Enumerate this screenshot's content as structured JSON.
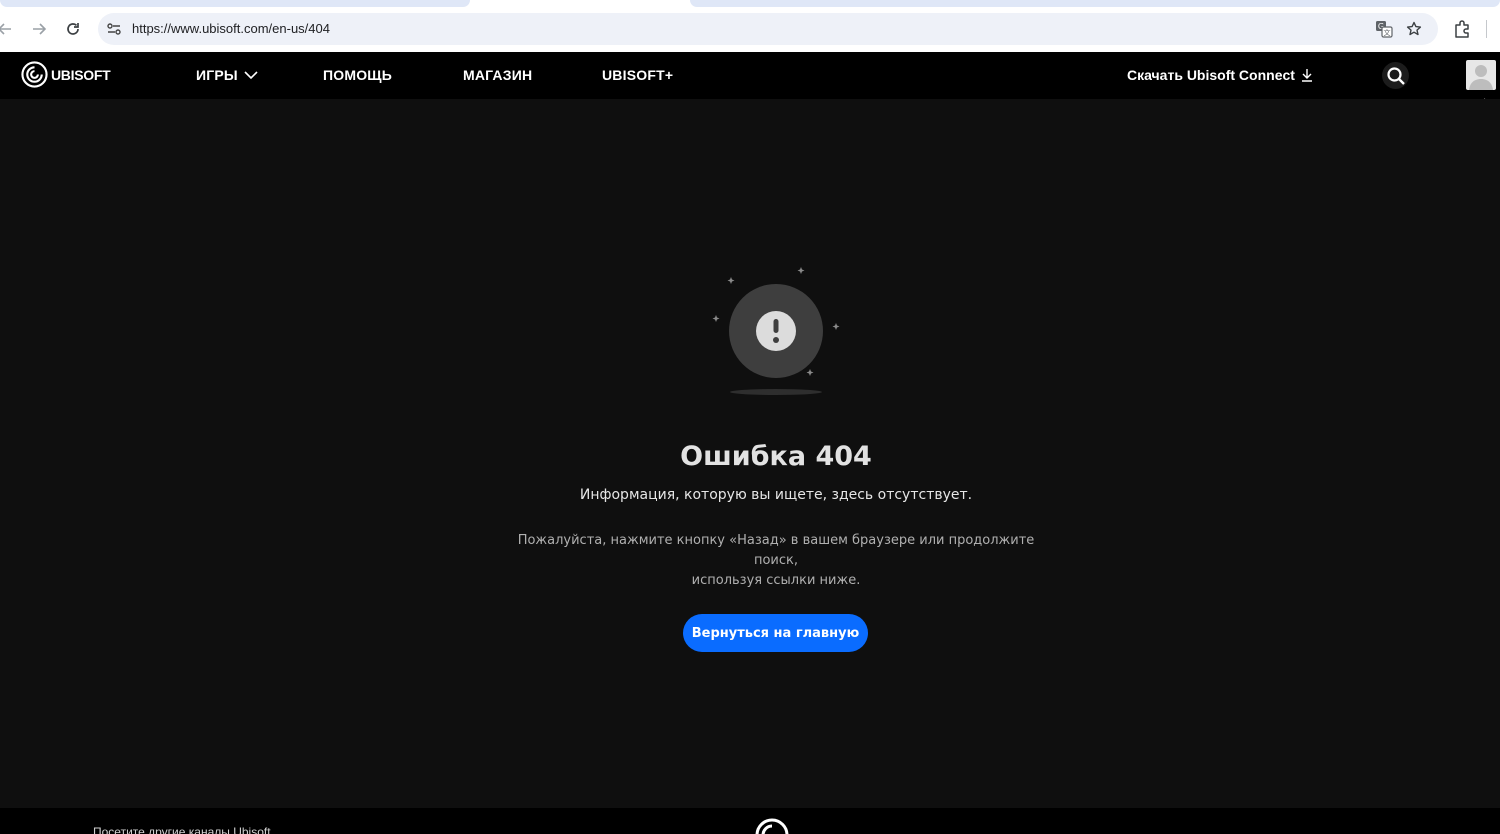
{
  "browser": {
    "url": "https://www.ubisoft.com/en-us/404",
    "icons": [
      "back-icon",
      "forward-icon",
      "reload-icon",
      "site-info-icon",
      "translate-icon",
      "bookmark-star-icon",
      "extensions-icon"
    ]
  },
  "header": {
    "logo_text": "UBISOFT",
    "nav": [
      {
        "label": "ИГРЫ",
        "has_dropdown": true
      },
      {
        "label": "ПОМОЩЬ"
      },
      {
        "label": "МАГАЗИН"
      },
      {
        "label": "UBISOFT+"
      }
    ],
    "download_label": "Скачать Ubisoft Connect",
    "icons": [
      "download-icon",
      "search-icon",
      "avatar"
    ]
  },
  "main": {
    "title": "Ошибка 404",
    "subtitle": "Информация, которую вы ищете, здесь отсутствует.",
    "hint_line1": "Пожалуйста, нажмите кнопку «Назад» в вашем браузере или продолжите поиск,",
    "hint_line2": "используя ссылки ниже.",
    "button_label": "Вернуться на главную",
    "icon": "exclamation-icon"
  },
  "footer": {
    "text": "Посетите другие каналы Ubisoft"
  },
  "colors": {
    "page_bg": "#0f0f0f",
    "header_bg": "#000000",
    "button_bg": "#0a6cff",
    "title_text": "#e2e2e2"
  }
}
